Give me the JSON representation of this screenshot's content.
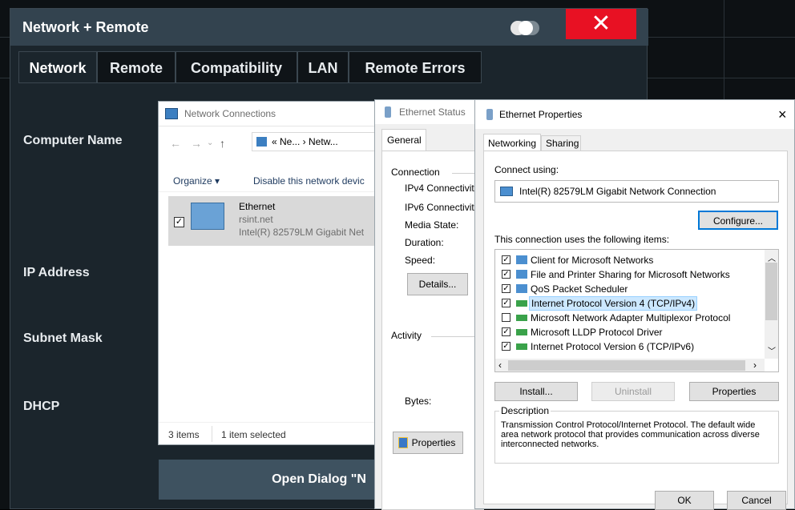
{
  "rs": {
    "title": "Network + Remote",
    "close_glyph": "✕",
    "tabs": [
      "Network",
      "Remote",
      "Compatibility",
      "LAN",
      "Remote Errors"
    ],
    "labels": {
      "computer_name": "Computer Name",
      "ip_address": "IP Address",
      "subnet_mask": "Subnet Mask",
      "dhcp": "DHCP"
    },
    "open_dialog": "Open Dialog \"N"
  },
  "netconn": {
    "title": "Network Connections",
    "address": "« Ne... › Netw...",
    "organize": "Organize ▾",
    "disable": "Disable this network devic",
    "item": {
      "name": "Ethernet",
      "domain": "rsint.net",
      "adapter": "Intel(R) 82579LM Gigabit Net"
    },
    "status": {
      "items": "3 items",
      "selected": "1 item selected"
    }
  },
  "ethstatus": {
    "title": "Ethernet Status",
    "tab": "General",
    "connection": "Connection",
    "ipv4": "IPv4 Connectivit",
    "ipv6": "IPv6 Connectivit",
    "media": "Media State:",
    "duration": "Duration:",
    "speed": "Speed:",
    "details": "Details...",
    "activity": "Activity",
    "bytes": "Bytes:",
    "properties": "Properties"
  },
  "ethprops": {
    "title": "Ethernet Properties",
    "tabs": [
      "Networking",
      "Sharing"
    ],
    "connect_using": "Connect using:",
    "adapter": "Intel(R) 82579LM Gigabit Network Connection",
    "configure": "Configure...",
    "items_label": "This connection uses the following items:",
    "items": [
      {
        "label": "Client for Microsoft Networks",
        "checked": true
      },
      {
        "label": "File and Printer Sharing for Microsoft Networks",
        "checked": true
      },
      {
        "label": "QoS Packet Scheduler",
        "checked": true
      },
      {
        "label": "Internet Protocol Version 4 (TCP/IPv4)",
        "checked": true,
        "selected": true
      },
      {
        "label": "Microsoft Network Adapter Multiplexor Protocol",
        "checked": false
      },
      {
        "label": "Microsoft LLDP Protocol Driver",
        "checked": true
      },
      {
        "label": "Internet Protocol Version 6 (TCP/IPv6)",
        "checked": true
      }
    ],
    "install": "Install...",
    "uninstall": "Uninstall",
    "properties": "Properties",
    "description_label": "Description",
    "description": "Transmission Control Protocol/Internet Protocol. The default wide area network protocol that provides communication across diverse interconnected networks.",
    "ok": "OK",
    "cancel": "Cancel"
  },
  "colors": {
    "close_red": "#e81123",
    "selection_blue": "#cce8ff",
    "selected_item": "#0078d7"
  }
}
